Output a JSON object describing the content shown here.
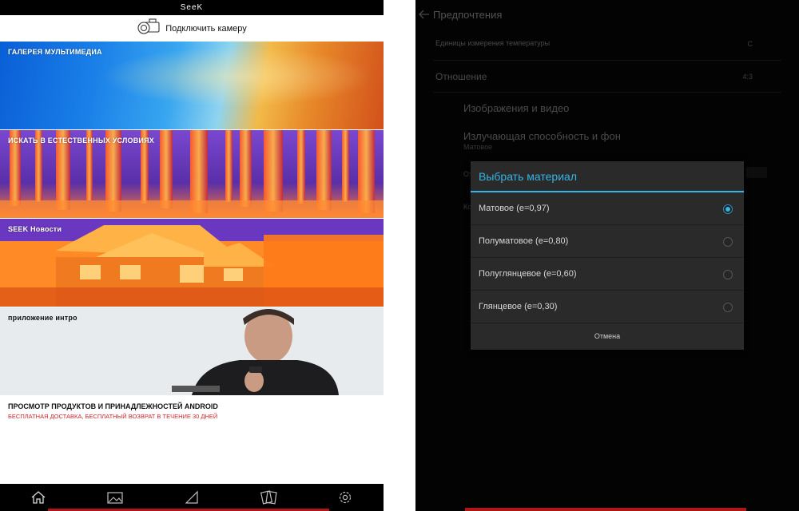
{
  "left": {
    "status_bar": {
      "brand": "SeeK"
    },
    "connect": {
      "label": "Подключить камеру",
      "icon": "thermal-camera-icon"
    },
    "tiles": [
      {
        "label": "ГАЛЕРЕЯ МУЛЬТИМЕДИА"
      },
      {
        "label": "ИСКАТЬ В ЕСТЕСТВЕННЫХ УСЛОВИЯХ"
      },
      {
        "label": "SEEK Новости"
      },
      {
        "label": "приложение интро"
      }
    ],
    "promo": {
      "title": "ПРОСМОТР ПРОДУКТОВ И ПРИНАДЛЕЖНОСТЕЙ ANDROID",
      "subtitle": "БЕСПЛАТНАЯ ДОСТАВКА, БЕСПЛАТНЫЙ ВОЗВРАТ В ТЕЧЕНИЕ 30 ДНЕЙ"
    },
    "bottom_nav": [
      "home-icon",
      "gallery-icon",
      "ruler-icon",
      "cards-icon",
      "gear-icon"
    ]
  },
  "right": {
    "header": {
      "title": "Предпочтения",
      "back_icon": "arrow-left-icon"
    },
    "rows": {
      "temp_units": {
        "label": "Единицы измерения температуры",
        "value": "C"
      },
      "ratio": {
        "label": "Отношение",
        "value": "4:3"
      }
    },
    "sub_items": {
      "images_video": {
        "label": "Изображения и видео"
      },
      "emissivity": {
        "label": "Излучающая способность и фон",
        "value": "Матовое"
      },
      "partial_1": {
        "label": "От"
      },
      "partial_2": {
        "label": "Ко"
      }
    },
    "dialog": {
      "title": "Выбрать материал",
      "options": [
        {
          "label": "Матовое (е=0,97)",
          "selected": true
        },
        {
          "label": "Полуматовое (е=0,80)",
          "selected": false
        },
        {
          "label": "Полуглянцевое (е=0,60)",
          "selected": false
        },
        {
          "label": "Глянцевое (е=0,30)",
          "selected": false
        }
      ],
      "cancel": "Отмена"
    }
  },
  "colors": {
    "accent": "#35b5e5",
    "promo_red": "#d0242c",
    "nav_red": "#b01515"
  }
}
